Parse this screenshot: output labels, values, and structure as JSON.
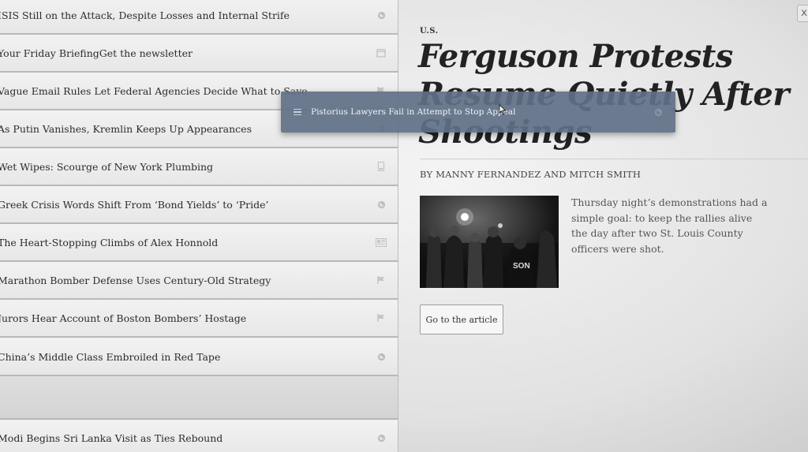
{
  "list": {
    "items": [
      {
        "title": "ISIS Still on the Attack, Despite Losses and Internal Strife",
        "icon": "globe-icon"
      },
      {
        "title": "Your Friday BriefingGet the newsletter",
        "icon": "calendar-icon"
      },
      {
        "title": "Vague Email Rules Let Federal Agencies Decide What to Save",
        "icon": "flag-icon"
      },
      {
        "title": "As Putin Vanishes, Kremlin Keeps Up Appearances",
        "icon": "globe-icon"
      },
      {
        "title": "Wet Wipes: Scourge of New York Plumbing",
        "icon": "bookmark-icon"
      },
      {
        "title": "Greek Crisis Words Shift From ‘Bond Yields’ to ‘Pride’",
        "icon": "globe-icon"
      },
      {
        "title": "The Heart-Stopping Climbs of Alex Honnold",
        "icon": "newspaper-icon"
      },
      {
        "title": "Marathon Bomber Defense Uses Century-Old Strategy",
        "icon": "flag-icon"
      },
      {
        "title": "Jurors Hear Account of Boston Bombers’ Hostage",
        "icon": "flag-icon"
      },
      {
        "title": "China’s Middle Class Embroiled in Red Tape",
        "icon": "globe-icon"
      },
      {
        "title": "Modi Begins Sri Lanka Visit as Ties Rebound",
        "icon": "globe-icon"
      }
    ]
  },
  "dragged_item": {
    "title": "Pistorius Lawyers Fail in Attempt to Stop Appeal",
    "icon": "globe-icon"
  },
  "article": {
    "section": "U.S.",
    "headline": "Ferguson Protests Resume Quietly After Shootings",
    "byline": "BY MANNY FERNANDEZ AND MITCH SMITH",
    "summary": "Thursday night’s demonstrations had a simple goal: to keep the rallies alive the day after two St. Louis County officers were shot.",
    "button_label": "Go to the article",
    "close_label": "X",
    "photo_shirt_text": "SON"
  },
  "colors": {
    "drag_bg": "#5f7087",
    "list_bg": "#efefef",
    "row_border": "#b9b9b9"
  }
}
